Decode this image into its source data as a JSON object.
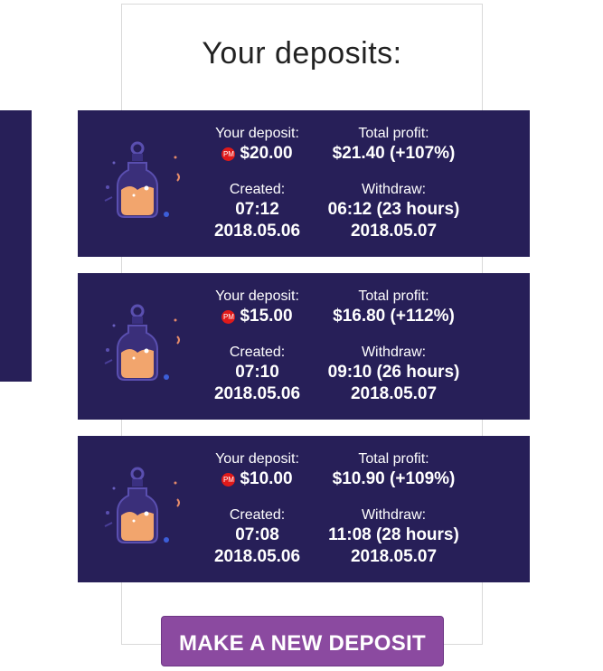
{
  "section": {
    "title": "Your deposits:"
  },
  "labels": {
    "your_deposit": "Your deposit:",
    "total_profit": "Total profit:",
    "created": "Created:",
    "withdraw": "Withdraw:",
    "pm_badge": "PM"
  },
  "deposits": [
    {
      "amount": "$20.00",
      "profit": "$21.40 (+107%)",
      "created_time": "07:12",
      "created_date": "2018.05.06",
      "withdraw_time": "06:12 (23 hours)",
      "withdraw_date": "2018.05.07"
    },
    {
      "amount": "$15.00",
      "profit": "$16.80 (+112%)",
      "created_time": "07:10",
      "created_date": "2018.05.06",
      "withdraw_time": "09:10 (26 hours)",
      "withdraw_date": "2018.05.07"
    },
    {
      "amount": "$10.00",
      "profit": "$10.90 (+109%)",
      "created_time": "07:08",
      "created_date": "2018.05.06",
      "withdraw_time": "11:08 (28 hours)",
      "withdraw_date": "2018.05.07"
    }
  ],
  "actions": {
    "new_deposit": "MAKE A NEW DEPOSIT"
  },
  "colors": {
    "card_bg": "#271f58",
    "button_bg": "#8b4aa0",
    "pm_badge": "#e01a1a"
  },
  "icons": {
    "card_illustration": "potion-bottle-icon",
    "payment_badge": "perfect-money-icon"
  }
}
